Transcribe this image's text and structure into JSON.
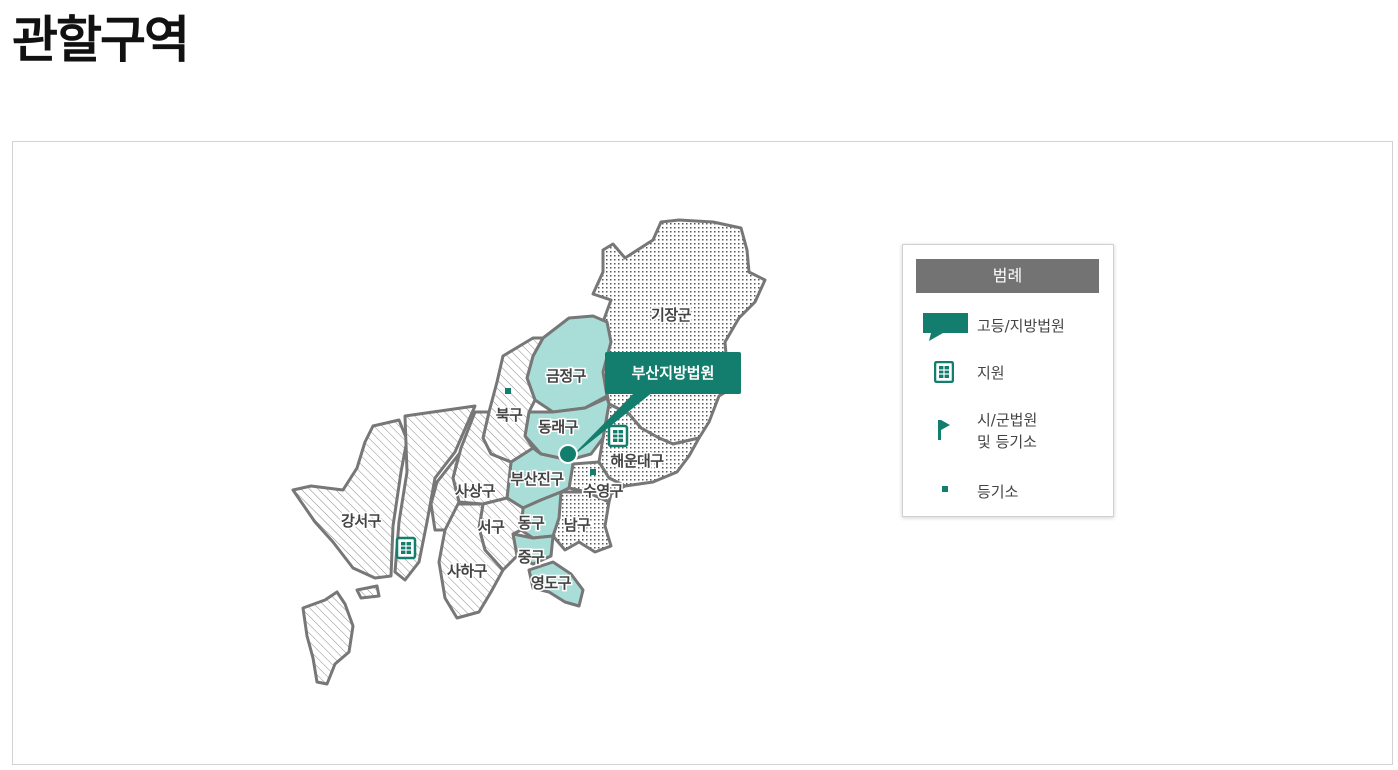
{
  "page": {
    "title": "관할구역"
  },
  "colors": {
    "court_green": "#137e6d",
    "highlight_area": "#a9ded8",
    "border": "#777777",
    "legend_header": "#737373"
  },
  "map": {
    "court_label": "부산지방법원",
    "districts": {
      "gijang": "기장군",
      "geumjeong": "금정구",
      "buk": "북구",
      "dongnae": "동래구",
      "haeundae": "해운대구",
      "sasang": "사상구",
      "busanjin": "부산진구",
      "suyeong": "수영구",
      "gangseo": "강서구",
      "seo": "서구",
      "dong": "동구",
      "nam": "남구",
      "jung": "중구",
      "saha": "사하구",
      "yeongdo": "영도구"
    },
    "marker_icons": [
      "building-icon",
      "court-pin-icon",
      "registry-dot-icon"
    ]
  },
  "legend": {
    "title": "범례",
    "items": [
      {
        "icon": "speech-flag-icon",
        "label": "고등/지방법원"
      },
      {
        "icon": "building-icon",
        "label": "지원"
      },
      {
        "icon": "flag-icon",
        "label_line1": "시/군법원",
        "label_line2": "및 등기소"
      },
      {
        "icon": "square-dot-icon",
        "label": "등기소"
      }
    ]
  }
}
